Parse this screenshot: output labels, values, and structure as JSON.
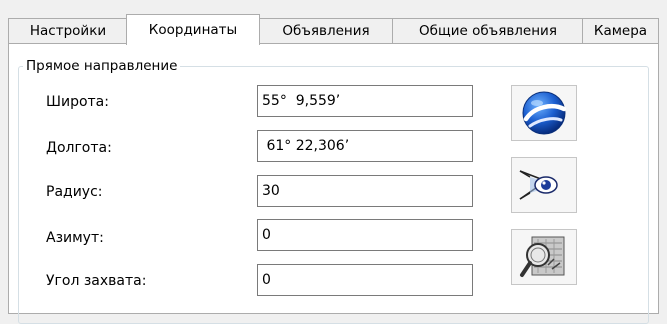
{
  "tabs": [
    {
      "label": "Настройки",
      "active": false
    },
    {
      "label": "Координаты",
      "active": true
    },
    {
      "label": "Объявления",
      "active": false
    },
    {
      "label": "Общие объявления",
      "active": false
    },
    {
      "label": "Камера",
      "active": false
    }
  ],
  "group": {
    "title": "Прямое направление"
  },
  "fields": {
    "latitude": {
      "label": "Широта:",
      "value": "55°  9,559’"
    },
    "longitude": {
      "label": "Долгота:",
      "value": " 61° 22,306’"
    },
    "radius": {
      "label": "Радиус:",
      "value": "30"
    },
    "azimuth": {
      "label": "Азимут:",
      "value": "0"
    },
    "capture_angle": {
      "label": "Угол захвата:",
      "value": "0"
    }
  },
  "buttons": [
    {
      "icon": "google-earth-icon"
    },
    {
      "icon": "view-cone-icon"
    },
    {
      "icon": "map-search-icon"
    }
  ],
  "colors": {
    "accent_blue": "#1c5fd0",
    "border": "#acacac"
  }
}
